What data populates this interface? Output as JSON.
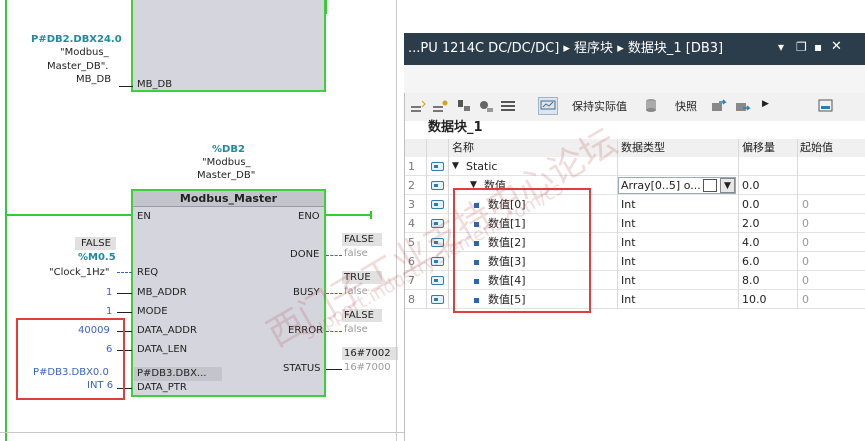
{
  "top_block": {
    "address": "P#DB2.DBX24.0",
    "name_line1": "\"Modbus_",
    "name_line2": "Master_DB\".",
    "name_line3": "MB_DB",
    "pin": "MB_DB"
  },
  "instance": {
    "db": "%DB2",
    "name_line1": "\"Modbus_",
    "name_line2": "Master_DB\""
  },
  "block": {
    "title": "Modbus_Master",
    "pins_left": [
      "EN",
      "REQ",
      "MB_ADDR",
      "MODE",
      "DATA_ADDR",
      "DATA_LEN",
      "P#DB3.DBX...",
      "DATA_PTR"
    ],
    "pins_right": [
      "ENO",
      "DONE",
      "BUSY",
      "ERROR",
      "STATUS"
    ]
  },
  "inputs": {
    "req_status": "FALSE",
    "req_addr": "%M0.5",
    "req_tag": "\"Clock_1Hz\"",
    "mb_addr": "1",
    "mode": "1",
    "data_addr": "40009",
    "data_len": "6",
    "data_ptr_line1": "P#DB3.DBX0.0",
    "data_ptr_line2": "INT 6"
  },
  "outputs": {
    "done_status": "FALSE",
    "done_value": "false",
    "busy_status": "TRUE",
    "busy_value": "false",
    "error_status": "FALSE",
    "error_value": "false",
    "status_status": "16#7002",
    "status_value": "16#7000"
  },
  "panel": {
    "title": "...PU 1214C DC/DC/DC] ▸ 程序块 ▸ 数据块_1 [DB3]",
    "title_buttons": [
      "▾",
      "❐",
      "▪",
      "✕"
    ],
    "toolbar": {
      "keep_actual": "保持实际值",
      "snapshot": "快照"
    },
    "block_name": "数据块_1",
    "columns": [
      "名称",
      "数据类型",
      "偏移量",
      "起始值"
    ],
    "rows": [
      {
        "num": "1",
        "name": "Static",
        "type": "",
        "offset": "",
        "start": "",
        "indent": 0,
        "toggle": "▼"
      },
      {
        "num": "2",
        "name": "数值",
        "type": "Array[0..5] o...",
        "offset": "0.0",
        "start": "",
        "indent": 1,
        "toggle": "▼"
      },
      {
        "num": "3",
        "name": "数值[0]",
        "type": "Int",
        "offset": "0.0",
        "start": "0",
        "indent": 2,
        "toggle": ""
      },
      {
        "num": "4",
        "name": "数值[1]",
        "type": "Int",
        "offset": "2.0",
        "start": "0",
        "indent": 2,
        "toggle": ""
      },
      {
        "num": "5",
        "name": "数值[2]",
        "type": "Int",
        "offset": "4.0",
        "start": "0",
        "indent": 2,
        "toggle": ""
      },
      {
        "num": "6",
        "name": "数值[3]",
        "type": "Int",
        "offset": "6.0",
        "start": "0",
        "indent": 2,
        "toggle": ""
      },
      {
        "num": "7",
        "name": "数值[4]",
        "type": "Int",
        "offset": "8.0",
        "start": "0",
        "indent": 2,
        "toggle": ""
      },
      {
        "num": "8",
        "name": "数值[5]",
        "type": "Int",
        "offset": "10.0",
        "start": "0",
        "indent": 2,
        "toggle": ""
      }
    ]
  },
  "watermark": {
    "line1": "西门子工业支持中心论坛",
    "line2": "support.industry.siemens.com/cs"
  },
  "colors": {
    "wire": "#32cd32",
    "teal": "#1c8c9c",
    "blue": "#3a63c6",
    "highlight": "#e23c3c",
    "titlebar": "#2b3c4a"
  }
}
